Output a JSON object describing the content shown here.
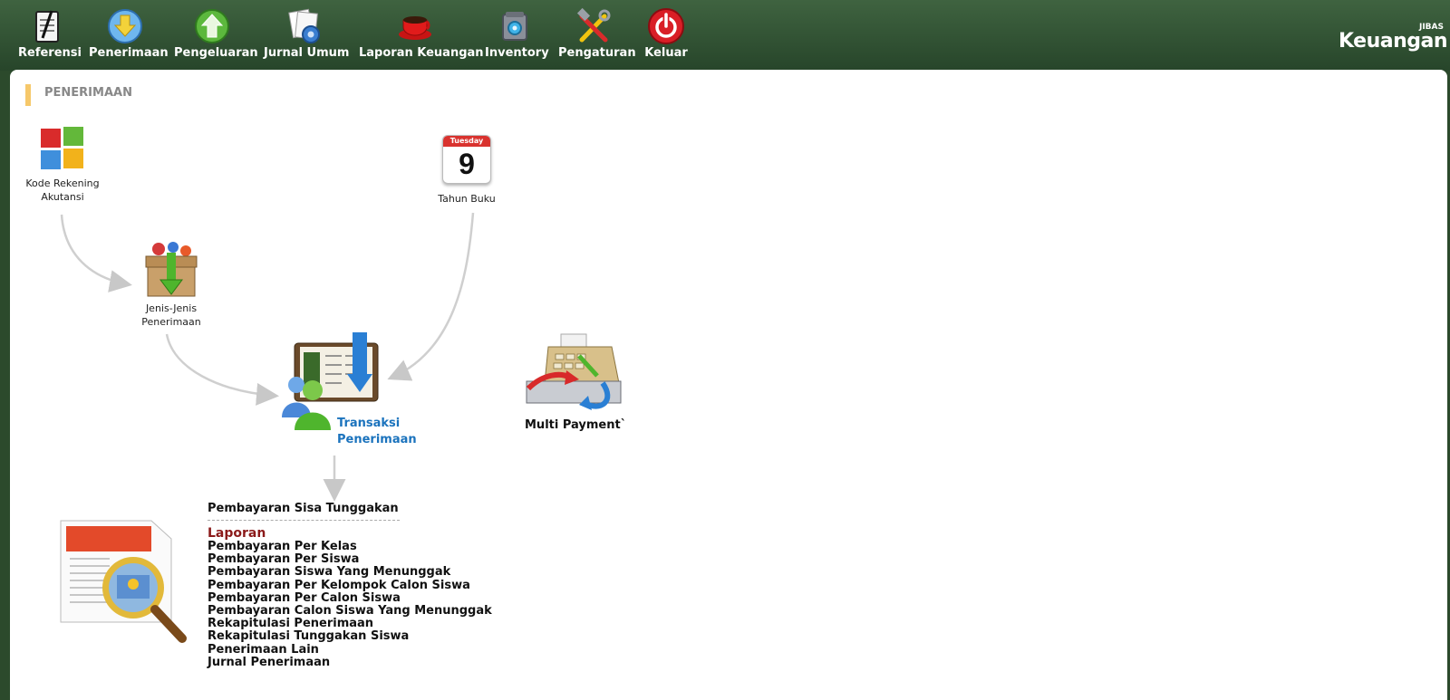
{
  "toolbar": {
    "items": [
      {
        "label": "Referensi",
        "icon": "notepad-icon"
      },
      {
        "label": "Penerimaan",
        "icon": "download-arrow-icon"
      },
      {
        "label": "Pengeluaran",
        "icon": "upload-arrow-icon"
      },
      {
        "label": "Jurnal Umum",
        "icon": "journal-gear-icon"
      },
      {
        "label": "Laporan Keuangan",
        "icon": "coffee-cup-icon"
      },
      {
        "label": "Inventory",
        "icon": "camera-box-icon"
      },
      {
        "label": "Pengaturan",
        "icon": "tools-icon"
      },
      {
        "label": "Keluar",
        "icon": "power-icon"
      }
    ],
    "brand_small": "JIBAS",
    "brand_big": "Keuangan"
  },
  "section_title": "PENERIMAAN",
  "nodes": {
    "kode_rekening": {
      "line1": "Kode Rekening",
      "line2": "Akutansi"
    },
    "tahun_buku": {
      "label": "Tahun Buku",
      "calendar_day": "Tuesday",
      "calendar_date": "9"
    },
    "jenis": {
      "line1": "Jenis-Jenis",
      "line2": "Penerimaan"
    },
    "transaksi": {
      "line1": "Transaksi",
      "line2": "Penerimaan"
    },
    "multi_payment": {
      "label": "Multi Payment`"
    }
  },
  "links": {
    "sisa_tunggakan": "Pembayaran Sisa Tunggakan",
    "laporan_heading": "Laporan",
    "laporan_items": [
      "Pembayaran Per Kelas",
      "Pembayaran Per Siswa",
      "Pembayaran Siswa Yang Menunggak",
      "Pembayaran Per Kelompok Calon Siswa",
      "Pembayaran Per Calon Siswa",
      "Pembayaran Calon Siswa Yang Menunggak",
      "Rekapitulasi Penerimaan",
      "Rekapitulasi Tunggakan Siswa",
      "Penerimaan Lain",
      "Jurnal Penerimaan"
    ]
  },
  "colors": {
    "toolbar_green": "#2f4f31",
    "accent_orange": "#f6c86a",
    "link_blue": "#1b73bd",
    "heading_red": "#8b1a1a"
  }
}
